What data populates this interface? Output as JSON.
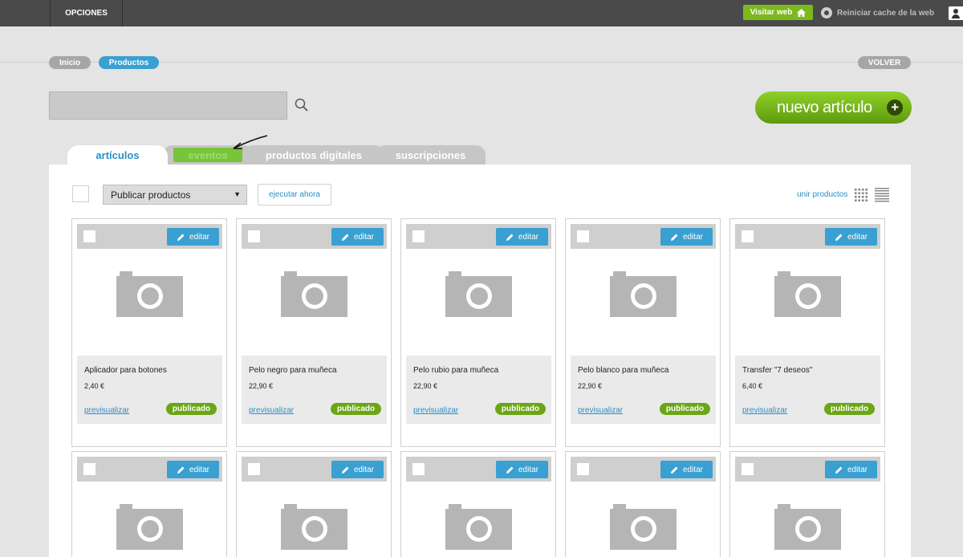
{
  "topbar": {
    "options_label": "OPCIONES",
    "visit_label": "Visitar web",
    "reset_label": "Reiniciar cache de la web"
  },
  "breadcrumb": {
    "items": [
      "Inicio",
      "Productos"
    ],
    "back_label": "VOLVER"
  },
  "search": {
    "value": ""
  },
  "new_item_label": "nuevo artículo",
  "tabs": [
    "artículos",
    "eventos",
    "productos digitales",
    "suscripciones"
  ],
  "toolbar": {
    "bulk_action": "Publicar productos",
    "execute_label": "ejecutar ahora",
    "merge_label": "unir productos"
  },
  "card_labels": {
    "edit": "editar",
    "preview": "previsualizar",
    "status": "publicado"
  },
  "products": [
    {
      "name": "Aplicador para botones",
      "price": "2,40 €"
    },
    {
      "name": "Pelo negro para muñeca",
      "price": "22,90 €"
    },
    {
      "name": "Pelo rubio para muñeca",
      "price": "22,90 €"
    },
    {
      "name": "Pelo blanco para muñeca",
      "price": "22,90 €"
    },
    {
      "name": "Transfer \"7 deseos\"",
      "price": "6,40 €"
    }
  ],
  "icons": [
    "home-icon",
    "refresh-icon",
    "user-icon",
    "search-icon",
    "plus-icon",
    "grid-view-icon",
    "list-view-icon",
    "pencil-icon",
    "camera-icon",
    "arrow-annotation-icon"
  ],
  "colors": {
    "accent_blue": "#3aa0d1",
    "accent_green": "#7cb91c",
    "topbar": "#4a4a4a"
  }
}
